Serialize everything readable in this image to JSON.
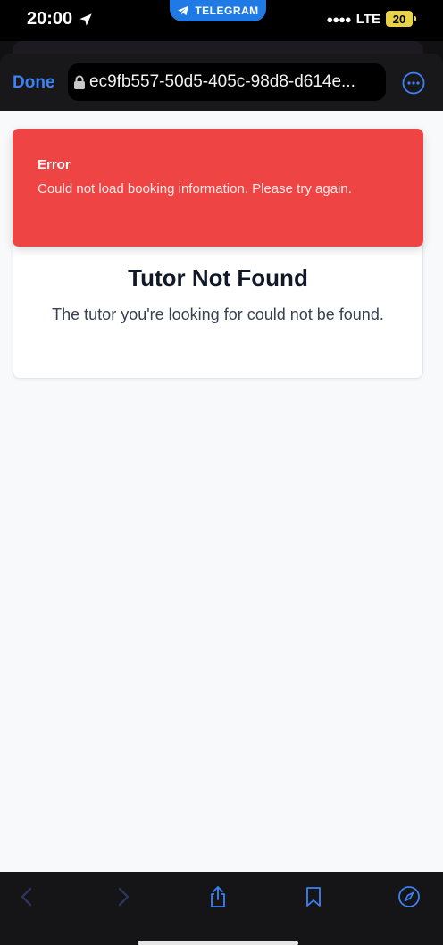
{
  "status_bar": {
    "time": "20:00",
    "telegram_label": "TELEGRAM",
    "network": "LTE",
    "battery": "20"
  },
  "browser": {
    "done_label": "Done",
    "url": "ec9fb557-50d5-405c-98d8-d614e..."
  },
  "error_toast": {
    "title": "Error",
    "message": "Could not load booking information. Please try again."
  },
  "tutor_card": {
    "title": "Tutor Not Found",
    "message": "The tutor you're looking for could not be found."
  },
  "bottom_toolbar": {
    "icons": [
      "back-icon",
      "forward-icon",
      "share-icon",
      "bookmarks-icon",
      "compass-icon"
    ]
  },
  "colors": {
    "error_bg": "#ef4444",
    "link_blue": "#3b82f6",
    "telegram_blue": "#1f7ae6"
  }
}
